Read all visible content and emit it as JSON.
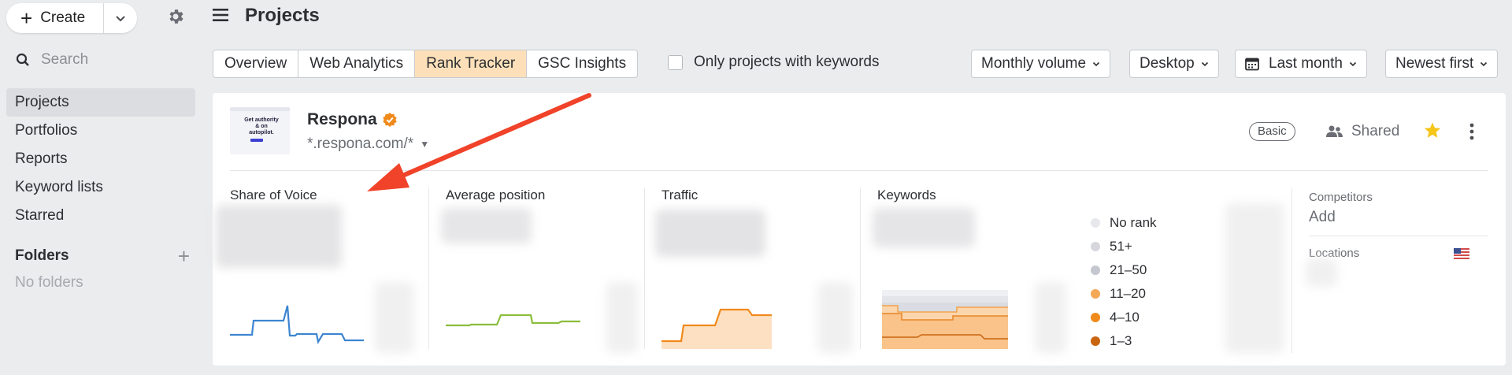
{
  "sidebar": {
    "create_label": "Create",
    "search_placeholder": "Search",
    "nav_items": [
      {
        "label": "Projects",
        "active": true
      },
      {
        "label": "Portfolios"
      },
      {
        "label": "Reports"
      },
      {
        "label": "Keyword lists"
      },
      {
        "label": "Starred"
      }
    ],
    "folders_label": "Folders",
    "no_folders_label": "No folders"
  },
  "header": {
    "title": "Projects"
  },
  "tabs": [
    {
      "label": "Overview"
    },
    {
      "label": "Web Analytics"
    },
    {
      "label": "Rank Tracker",
      "active": true
    },
    {
      "label": "GSC Insights"
    }
  ],
  "filters": {
    "only_keywords_label": "Only projects with keywords",
    "volume_label": "Monthly volume",
    "device_label": "Desktop",
    "date_label": "Last month",
    "sort_label": "Newest first"
  },
  "project": {
    "name": "Respona",
    "url": "*.respona.com/*",
    "thumbnail_text": "Get authority & on autopilot.",
    "plan_badge": "Basic",
    "shared_label": "Shared",
    "metrics": {
      "share_of_voice": "Share of Voice",
      "average_position": "Average position",
      "traffic": "Traffic",
      "keywords": "Keywords"
    },
    "keyword_legend": [
      {
        "label": "No rank",
        "color": "#e6e8ec"
      },
      {
        "label": "51+",
        "color": "#d5d7dd"
      },
      {
        "label": "21–50",
        "color": "#c4c7d0"
      },
      {
        "label": "11–20",
        "color": "#f5a855"
      },
      {
        "label": "4–10",
        "color": "#f08a1c"
      },
      {
        "label": "1–3",
        "color": "#c9650f"
      }
    ],
    "competitors_label": "Competitors",
    "competitors_add": "Add",
    "locations_label": "Locations"
  },
  "colors": {
    "accent_tab": "#fde0b9",
    "sov_line": "#3d85d1",
    "avg_position_line": "#8bbd3c",
    "traffic_line": "#f08a1c",
    "annotation_arrow": "#f0432a",
    "star": "#f5c518",
    "verified": "#f08a1c"
  }
}
